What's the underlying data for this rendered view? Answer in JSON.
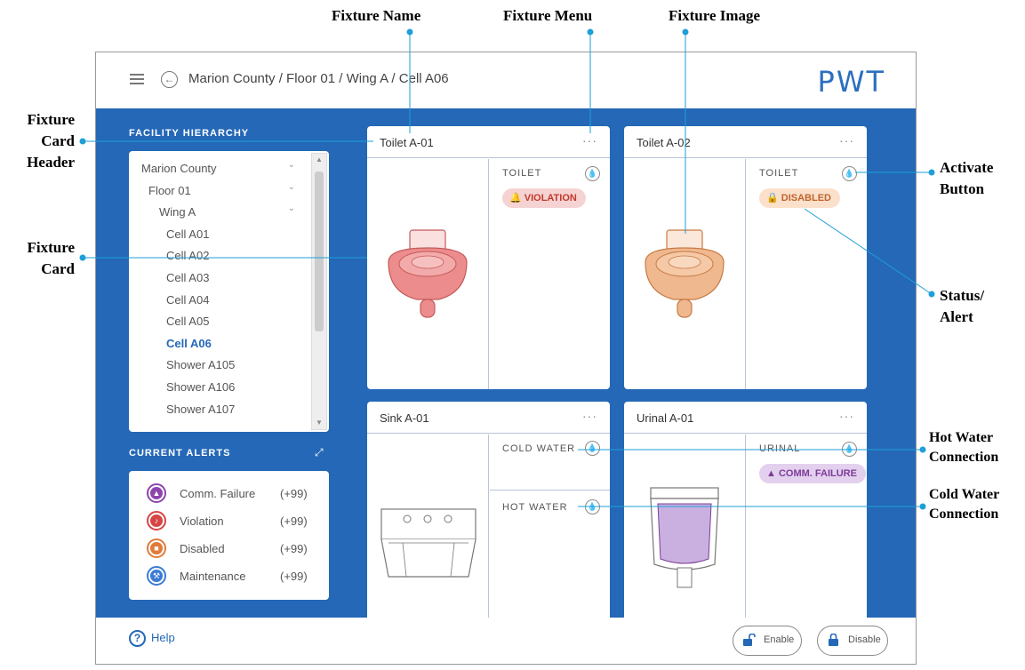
{
  "annotations": {
    "fixture_name": "Fixture Name",
    "fixture_menu": "Fixture Menu",
    "fixture_image": "Fixture Image",
    "fixture_card_header_1": "Fixture",
    "fixture_card_header_2": "Card",
    "fixture_card_header_3": "Header",
    "fixture_card_1": "Fixture",
    "fixture_card_2": "Card",
    "activate_button_1": "Activate",
    "activate_button_2": "Button",
    "status_alert_1": "Status/",
    "status_alert_2": "Alert",
    "hot_water_1": "Hot Water",
    "hot_water_2": "Connection",
    "cold_water_1": "Cold Water",
    "cold_water_2": "Connection"
  },
  "header": {
    "breadcrumb": "Marion County / Floor 01 / Wing A / Cell A06",
    "logo": "PWT"
  },
  "sidebar": {
    "hierarchy_title": "FACILITY HIERARCHY",
    "tree": [
      {
        "label": "Marion County",
        "indent": 0,
        "chevron": true
      },
      {
        "label": "Floor 01",
        "indent": 1,
        "chevron": true
      },
      {
        "label": "Wing A",
        "indent": 2,
        "chevron": true
      },
      {
        "label": "Cell A01",
        "indent": 3
      },
      {
        "label": "Cell A02",
        "indent": 3
      },
      {
        "label": "Cell A03",
        "indent": 3
      },
      {
        "label": "Cell A04",
        "indent": 3
      },
      {
        "label": "Cell A05",
        "indent": 3
      },
      {
        "label": "Cell A06",
        "indent": 3,
        "active": true
      },
      {
        "label": "Shower A105",
        "indent": 3
      },
      {
        "label": "Shower A106",
        "indent": 3
      },
      {
        "label": "Shower A107",
        "indent": 3
      }
    ],
    "alerts_title": "CURRENT ALERTS",
    "alerts": [
      {
        "label": "Comm. Failure",
        "count": "(+99)",
        "color": "#8e44ad",
        "icon": "warning-icon"
      },
      {
        "label": "Violation",
        "count": "(+99)",
        "color": "#d64545",
        "icon": "bell-icon"
      },
      {
        "label": "Disabled",
        "count": "(+99)",
        "color": "#e07b39",
        "icon": "lock-icon"
      },
      {
        "label": "Maintenance",
        "count": "(+99)",
        "color": "#3a7bd5",
        "icon": "wrench-icon"
      }
    ]
  },
  "cards": {
    "toilet1": {
      "name": "Toilet A-01",
      "menu": "···",
      "type": "TOILET",
      "status": "VIOLATION",
      "status_color": "#c0392b",
      "status_bg": "#f6d3d3"
    },
    "toilet2": {
      "name": "Toilet A-02",
      "menu": "···",
      "type": "TOILET",
      "status": "DISABLED",
      "status_color": "#c0642b",
      "status_bg": "#fbe0cc"
    },
    "sink": {
      "name": "Sink A-01",
      "menu": "···",
      "cold": "COLD WATER",
      "hot": "HOT WATER"
    },
    "urinal": {
      "name": "Urinal A-01",
      "menu": "···",
      "type": "URINAL",
      "status": "COMM. FAILURE",
      "status_color": "#7d3c98",
      "status_bg": "#e3d0ee"
    }
  },
  "footer": {
    "help": "Help",
    "enable": "Enable",
    "disable": "Disable"
  },
  "colors": {
    "brand_blue": "#2468b7",
    "violation": "#d64545",
    "disabled": "#e07b39",
    "comm_failure": "#8e44ad",
    "maintenance": "#3a7bd5"
  }
}
